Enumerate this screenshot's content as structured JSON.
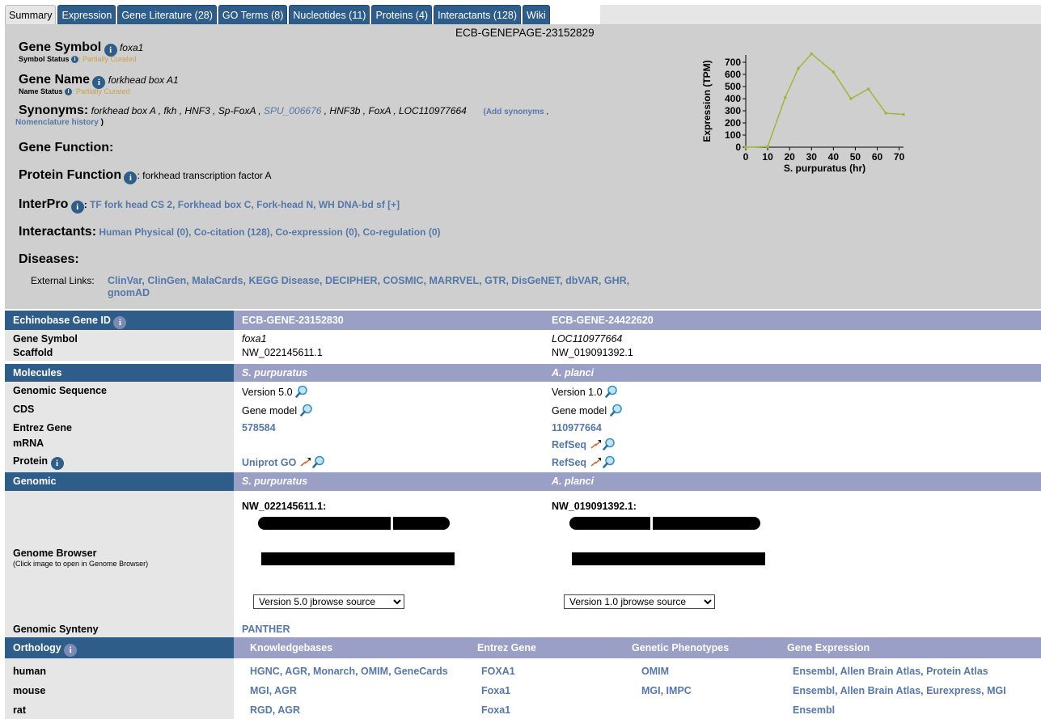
{
  "tabs": [
    "Summary",
    "Expression",
    "Gene Literature (28)",
    "GO Terms (8)",
    "Nucleotides (11)",
    "Proteins (4)",
    "Interactants (128)",
    "Wiki"
  ],
  "page_id": "ECB-GENEPAGE-23152829",
  "summary": {
    "gene_symbol_label": "Gene Symbol",
    "gene_symbol": "foxa1",
    "symbol_status_label": "Symbol Status",
    "symbol_status": ": Partially Curated",
    "gene_name_label": "Gene Name",
    "gene_name": "forkhead box A1",
    "name_status_label": "Name Status",
    "name_status": ": Partially Curated",
    "synonyms_label": "Synonyms:",
    "synonyms_a": "forkhead box A , fkh , HNF3 , Sp-FoxA ,",
    "synonyms_link": "SPU_006676",
    "synonyms_b": ", HNF3b , FoxA , LOC110977664",
    "add_synonyms": "(Add synonyms",
    "nomenclature": "Nomenclature history",
    "gene_function_label": "Gene Function:",
    "protein_function_label": "Protein Function",
    "protein_function": ": forkhead transcription factor A",
    "interpro_label": "InterPro",
    "interpro_links": [
      "TF fork head CS 2",
      "Forkhead box C",
      "Fork-head N",
      "WH DNA-bd sf [+]"
    ],
    "interactants_label": "Interactants:",
    "interactant_links": [
      "Human Physical (0)",
      "Co-citation (128)",
      "Co-expression (0)",
      "Co-regulation (0)"
    ],
    "diseases_label": "Diseases:",
    "external_links_label": "External Links:",
    "external_links": [
      "ClinVar",
      "ClinGen",
      "MalaCards",
      "KEGG Disease",
      "DECIPHER",
      "COSMIC",
      "MARRVEL",
      "GTR",
      "DisGeNET",
      "dbVAR",
      "GHR",
      "gnomAD"
    ]
  },
  "chart_data": {
    "type": "line",
    "xlabel": "S. purpuratus (hr)",
    "ylabel": "Expression (TPM)",
    "xlim": [
      0,
      72
    ],
    "ylim": [
      0,
      760
    ],
    "xticks": [
      0,
      10,
      20,
      30,
      40,
      50,
      60,
      70
    ],
    "yticks": [
      0,
      100,
      200,
      300,
      400,
      500,
      600,
      700
    ],
    "x": [
      0,
      10,
      18,
      24,
      30,
      40,
      48,
      56,
      64,
      72
    ],
    "y": [
      0,
      5,
      410,
      650,
      770,
      620,
      400,
      480,
      280,
      270
    ],
    "color": "#9ab83a"
  },
  "table": {
    "id_header": "Echinobase Gene ID",
    "gene_ids": [
      "ECB-GENE-23152830",
      "ECB-GENE-24422620"
    ],
    "gene_symbol_label": "Gene Symbol",
    "gene_symbols": [
      "foxa1",
      "LOC110977664"
    ],
    "scaffold_label": "Scaffold",
    "scaffolds": [
      "NW_022145611.1",
      "NW_019091392.1"
    ],
    "molecules_header": "Molecules",
    "species": [
      "S. purpuratus",
      "A. planci"
    ],
    "genomic_sequence_label": "Genomic Sequence",
    "genomic_sequences": [
      "Version 5.0",
      "Version 1.0"
    ],
    "cds_label": "CDS",
    "cds": [
      "Gene model",
      "Gene model"
    ],
    "entrez_label": "Entrez Gene",
    "entrez": [
      "578584",
      "110977664"
    ],
    "mrna_label": "mRNA",
    "mrna": [
      "",
      "RefSeq"
    ],
    "protein_label": "Protein",
    "protein": [
      "Uniprot GO",
      "RefSeq"
    ],
    "genomic_header": "Genomic",
    "browser_label": "Genome Browser",
    "browser_sub": "(Click image to open in Genome Browser)",
    "browser_scaffolds": [
      "NW_022145611.1:",
      "NW_019091392.1:"
    ],
    "jbrowse": [
      "Version 5.0 jbrowse source",
      "Version 1.0 jbrowse source"
    ],
    "synteny_label": "Genomic Synteny",
    "synteny": "PANTHER",
    "orthology_header": "Orthology",
    "orthology_cols": [
      "Knowledgebases",
      "Entrez Gene",
      "Genetic Phenotypes",
      "Gene Expression"
    ],
    "orthology_rows": [
      {
        "species": "human",
        "kb": "HGNC, AGR, Monarch, OMIM, GeneCards",
        "entrez": "FOXA1",
        "pheno": "OMIM",
        "expr": "Ensembl, Allen Brain Atlas, Protein Atlas"
      },
      {
        "species": "mouse",
        "kb": "MGI, AGR",
        "entrez": "Foxa1",
        "pheno": "MGI, IMPC",
        "expr": "Ensembl, Allen Brain Atlas, Eurexpress, MGI"
      },
      {
        "species": "rat",
        "kb": "RGD, AGR",
        "entrez": "Foxa1",
        "pheno": "",
        "expr": "Ensembl"
      }
    ]
  }
}
